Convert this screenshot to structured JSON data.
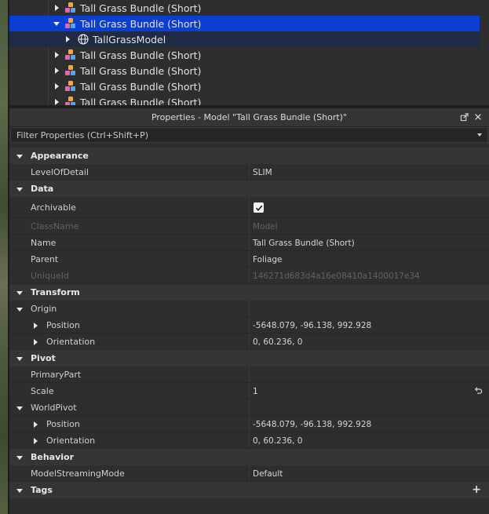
{
  "explorer": {
    "items": [
      {
        "label": "Tall Grass Bundle (Short)",
        "state": "collapsed"
      },
      {
        "label": "Tall Grass Bundle (Short)",
        "state": "expanded",
        "selected": true
      },
      {
        "label": "TallGrassModel",
        "state": "collapsed",
        "child": true,
        "icon": "globe-icon"
      },
      {
        "label": "Tall Grass Bundle (Short)",
        "state": "collapsed"
      },
      {
        "label": "Tall Grass Bundle (Short)",
        "state": "collapsed"
      },
      {
        "label": "Tall Grass Bundle (Short)",
        "state": "collapsed"
      },
      {
        "label": "Tall Grass Bundle (Short)",
        "state": "collapsed"
      }
    ]
  },
  "properties": {
    "title": "Properties - Model \"Tall Grass Bundle (Short)\"",
    "filter_placeholder": "Filter Properties (Ctrl+Shift+P)",
    "categories": {
      "appearance": "Appearance",
      "data": "Data",
      "transform": "Transform",
      "pivot": "Pivot",
      "behavior": "Behavior",
      "tags": "Tags"
    },
    "rows": {
      "level_of_detail": {
        "name": "LevelOfDetail",
        "value": "SLIM"
      },
      "archivable": {
        "name": "Archivable",
        "checked": true
      },
      "class_name": {
        "name": "ClassName",
        "value": "Model"
      },
      "name": {
        "name": "Name",
        "value": "Tall Grass Bundle (Short)"
      },
      "parent": {
        "name": "Parent",
        "value": "Foliage"
      },
      "unique_id": {
        "name": "UniqueId",
        "value": "146271d683d4a16e08410a1400017e34"
      },
      "origin": {
        "name": "Origin"
      },
      "origin_position": {
        "name": "Position",
        "value": "-5648.079, -96.138, 992.928"
      },
      "origin_orientation": {
        "name": "Orientation",
        "value": "0, 60.236, 0"
      },
      "primary_part": {
        "name": "PrimaryPart",
        "value": ""
      },
      "scale": {
        "name": "Scale",
        "value": "1"
      },
      "world_pivot": {
        "name": "WorldPivot"
      },
      "pivot_position": {
        "name": "Position",
        "value": "-5648.079, -96.138, 992.928"
      },
      "pivot_orientation": {
        "name": "Orientation",
        "value": "0, 60.236, 0"
      },
      "model_streaming_mode": {
        "name": "ModelStreamingMode",
        "value": "Default"
      }
    }
  },
  "colors": {
    "selection": "#0b3fd1",
    "panel": "#2e2e2e",
    "category": "#353535"
  }
}
